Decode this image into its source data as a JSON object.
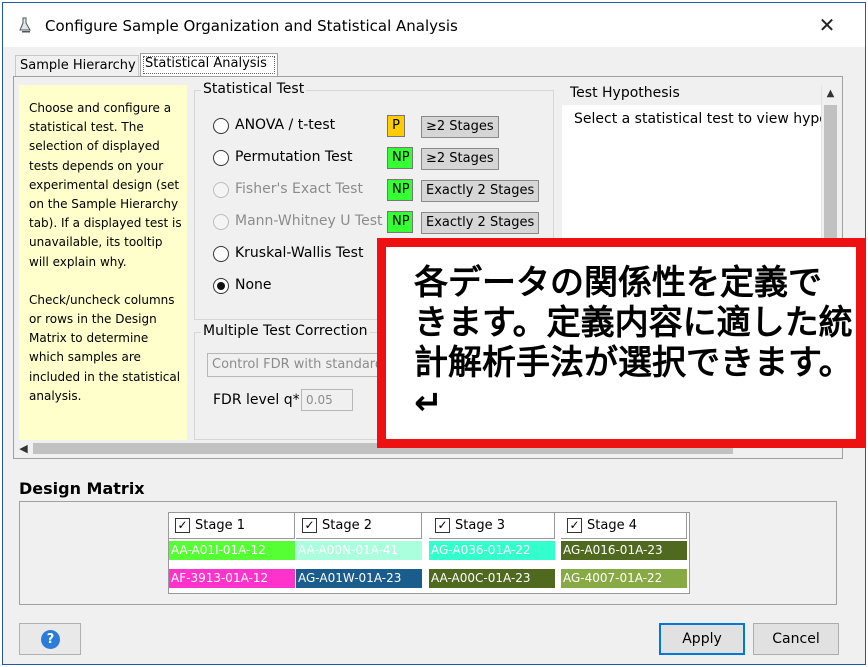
{
  "window": {
    "title": "Configure Sample Organization and Statistical Analysis",
    "close_glyph": "✕"
  },
  "tabs": [
    {
      "label": "Sample Hierarchy",
      "active": false
    },
    {
      "label": "Statistical Analysis",
      "active": true
    }
  ],
  "help_panel": {
    "paragraph1": "Choose and configure a statistical test. The selection of displayed tests depends on your experimental design (set on the Sample Hierarchy tab). If a displayed test is unavailable, its tooltip will explain why.",
    "paragraph2": "Check/uncheck columns or rows in the Design Matrix to determine which samples are included in the statistical analysis."
  },
  "statistical_test": {
    "label": "Statistical Test",
    "options": [
      {
        "label": "ANOVA / t-test",
        "selected": false,
        "disabled": false,
        "badge": "P",
        "badge_color": "#ffcc00",
        "stages": "≥2 Stages"
      },
      {
        "label": "Permutation Test",
        "selected": false,
        "disabled": false,
        "badge": "NP",
        "badge_color": "#33ff33",
        "stages": "≥2 Stages"
      },
      {
        "label": "Fisher's Exact Test",
        "selected": false,
        "disabled": true,
        "badge": "NP",
        "badge_color": "#33ff33",
        "stages": "Exactly 2 Stages"
      },
      {
        "label": "Mann-Whitney U Test",
        "selected": false,
        "disabled": true,
        "badge": "NP",
        "badge_color": "#33ff33",
        "stages": "Exactly 2 Stages"
      },
      {
        "label": "Kruskal-Wallis Test",
        "selected": false,
        "disabled": false
      },
      {
        "label": "None",
        "selected": true,
        "disabled": false
      }
    ]
  },
  "multiple_test_correction": {
    "label": "Multiple Test Correction",
    "method_value": "Control FDR with standard",
    "fdr_label": "FDR level q*",
    "fdr_value": "0.05"
  },
  "test_hypothesis": {
    "label": "Test Hypothesis",
    "text": "Select a statistical test to view hypot"
  },
  "design_matrix": {
    "title": "Design Matrix",
    "stages": [
      {
        "label": "Stage 1",
        "checked": true,
        "samples": [
          {
            "id": "AA-A01I-01A-12",
            "bg": "#55ff33",
            "fg": "#ffffff"
          },
          {
            "id": "AF-3913-01A-12",
            "bg": "#ff33cc",
            "fg": "#ffffff"
          }
        ]
      },
      {
        "label": "Stage 2",
        "checked": true,
        "samples": [
          {
            "id": "AA-A00N-01A-41",
            "bg": "#aaffdd",
            "fg": "#ffffff"
          },
          {
            "id": "AG-A01W-01A-23",
            "bg": "#1a5c8c",
            "fg": "#ffffff"
          }
        ]
      },
      {
        "label": "Stage 3",
        "checked": true,
        "samples": [
          {
            "id": "AG-A036-01A-22",
            "bg": "#33ffcc",
            "fg": "#ffffff"
          },
          {
            "id": "AA-A00C-01A-23",
            "bg": "#4f6a1f",
            "fg": "#ffffff"
          }
        ]
      },
      {
        "label": "Stage 4",
        "checked": true,
        "samples": [
          {
            "id": "AG-A016-01A-23",
            "bg": "#4f6a1f",
            "fg": "#ffffff"
          },
          {
            "id": "AG-4007-01A-22",
            "bg": "#88aa44",
            "fg": "#ffffff"
          }
        ]
      }
    ]
  },
  "footer": {
    "help_icon": "?",
    "apply_label": "Apply",
    "cancel_label": "Cancel"
  },
  "callout": {
    "text": "各データの関係性を定義できます。定義内容に適した統計解析手法が選択できます。↵",
    "border_color": "#ee1111"
  }
}
